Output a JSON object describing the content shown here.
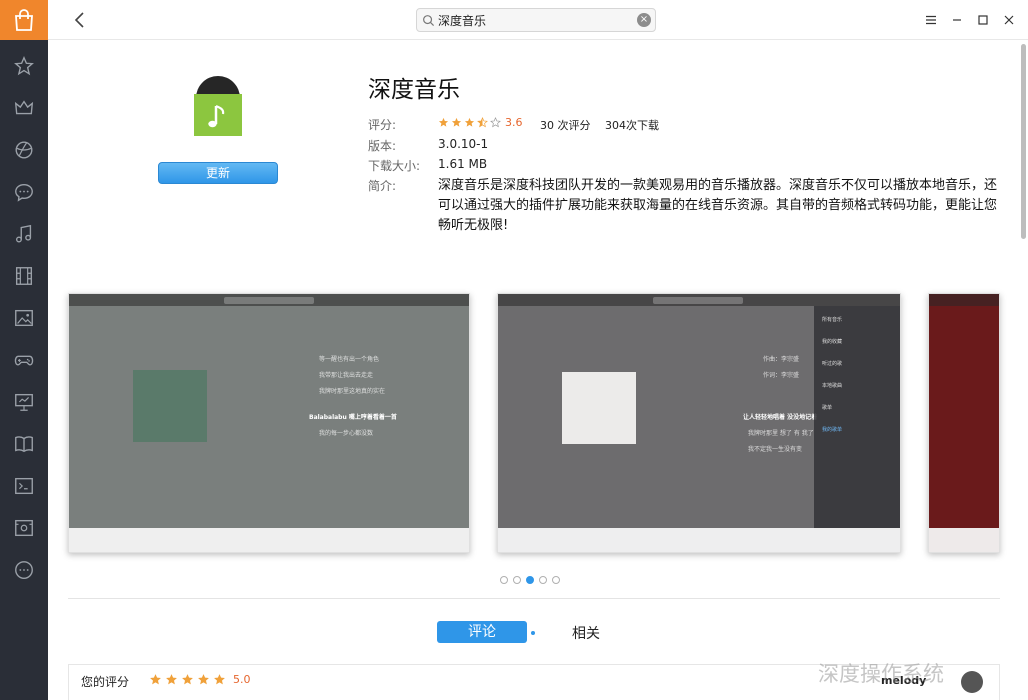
{
  "titlebar": {
    "search": {
      "value": "深度音乐"
    }
  },
  "sidebar": {
    "items": [
      {
        "icon": "star-icon"
      },
      {
        "icon": "crown-icon"
      },
      {
        "icon": "globe-icon"
      },
      {
        "icon": "chat-icon"
      },
      {
        "icon": "music-icon"
      },
      {
        "icon": "film-icon"
      },
      {
        "icon": "image-icon"
      },
      {
        "icon": "gamepad-icon"
      },
      {
        "icon": "presentation-icon"
      },
      {
        "icon": "book-icon"
      },
      {
        "icon": "terminal-icon"
      },
      {
        "icon": "safe-icon"
      },
      {
        "icon": "more-icon"
      }
    ]
  },
  "app": {
    "name": "深度音乐",
    "update_label": "更新",
    "rating_label": "评分:",
    "rating_value": "3.6",
    "rating_stars": 3.5,
    "rating_count": "30 次评分",
    "download_count": "304次下载",
    "version_label": "版本:",
    "version": "3.0.10-1",
    "size_label": "下载大小:",
    "size": "1.61 MB",
    "desc_label": "简介:",
    "description": "深度音乐是深度科技团队开发的一款美观易用的音乐播放器。深度音乐不仅可以播放本地音乐，还可以通过强大的插件扩展功能来获取海量的在线音乐资源。其自带的音频格式转码功能，更能让您畅听无极限!"
  },
  "screenshots": {
    "shot1_lyrics": [
      "等一醒也有出一个角色",
      "我带那让我出去走走",
      "我牌时那里这地真的实在",
      "Balabalabu 嘴上哼着看着一首",
      "我的每一步心都没数"
    ],
    "shot2_lyrics": [
      "作曲：李宗盛",
      "作词：李宗盛",
      "让人轻轻地唱着 没没地记着",
      "我牌时那里 想了 有 我了",
      "我不定我一生没有变"
    ],
    "shot2_panel": [
      "所有音乐",
      "我的收藏",
      "听过的歌",
      "本地歌曲",
      "歌单",
      "我的歌单"
    ],
    "active_dot": 3,
    "dot_count": 5
  },
  "tabs": {
    "comment": "评论",
    "related": "相关"
  },
  "review": {
    "my_rating_label": "您的评分",
    "my_stars": 5,
    "my_score": "5.0",
    "user": "melody"
  },
  "watermark": "深度操作系统",
  "colors": {
    "accent": "#2f96e8",
    "star": "#f0a13a",
    "logo_bg": "#f0862c",
    "sidebar_bg": "#2a2e37",
    "rating_text": "#e6662e"
  }
}
